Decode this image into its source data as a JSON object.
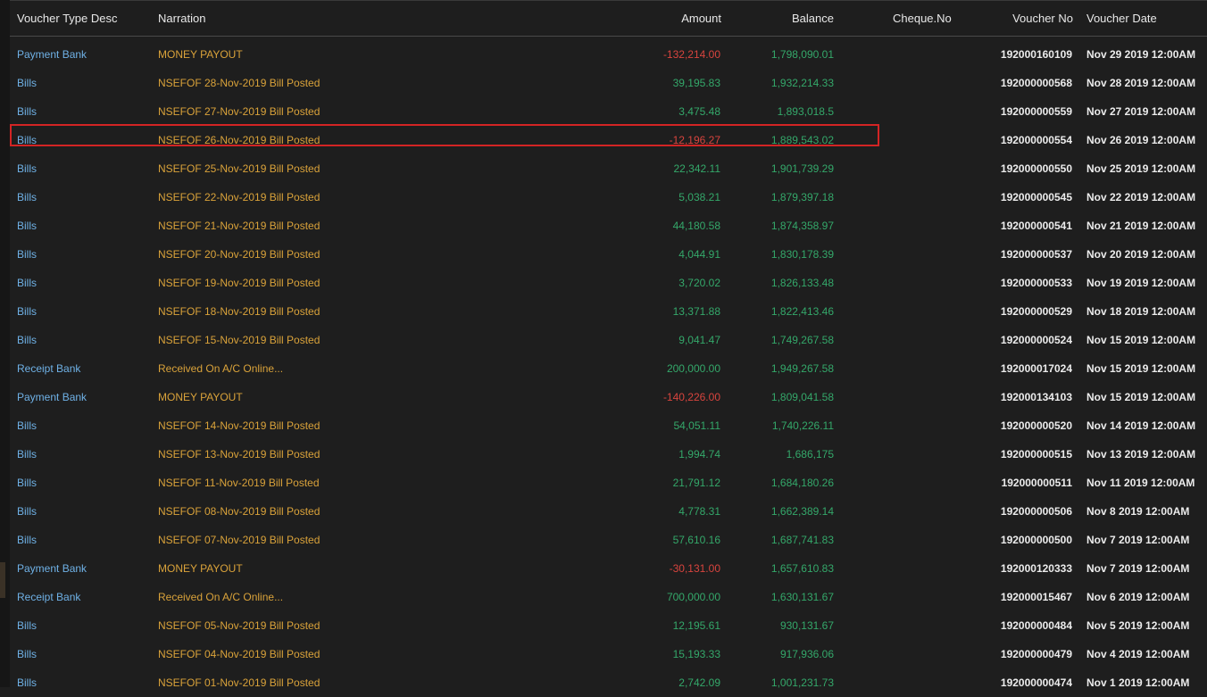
{
  "headers": {
    "type": "Voucher Type Desc",
    "narration": "Narration",
    "amount": "Amount",
    "balance": "Balance",
    "cheque": "Cheque.No",
    "voucher_no": "Voucher No",
    "voucher_date": "Voucher Date"
  },
  "colors": {
    "background": "#1e1e1e",
    "type_text": "#6fb1e6",
    "narration_text": "#d9a23a",
    "positive_amount": "#34a86a",
    "negative_amount": "#d8443e",
    "highlight_border": "#d32424"
  },
  "highlighted_row_index": 3,
  "rows": [
    {
      "type": "Payment Bank",
      "narration": "MONEY PAYOUT",
      "amount": "-132,214.00",
      "negative": true,
      "balance": "1,798,090.01",
      "cheque": "",
      "voucher_no": "192000160109",
      "voucher_date": "Nov 29 2019 12:00AM"
    },
    {
      "type": "Bills",
      "narration": "NSEFOF 28-Nov-2019 Bill Posted",
      "amount": "39,195.83",
      "negative": false,
      "balance": "1,932,214.33",
      "cheque": "",
      "voucher_no": "192000000568",
      "voucher_date": "Nov 28 2019 12:00AM"
    },
    {
      "type": "Bills",
      "narration": "NSEFOF 27-Nov-2019 Bill Posted",
      "amount": "3,475.48",
      "negative": false,
      "balance": "1,893,018.5",
      "cheque": "",
      "voucher_no": "192000000559",
      "voucher_date": "Nov 27 2019 12:00AM"
    },
    {
      "type": "Bills",
      "narration": "NSEFOF 26-Nov-2019 Bill Posted",
      "amount": "-12,196.27",
      "negative": true,
      "balance": "1,889,543.02",
      "cheque": "",
      "voucher_no": "192000000554",
      "voucher_date": "Nov 26 2019 12:00AM"
    },
    {
      "type": "Bills",
      "narration": "NSEFOF 25-Nov-2019 Bill Posted",
      "amount": "22,342.11",
      "negative": false,
      "balance": "1,901,739.29",
      "cheque": "",
      "voucher_no": "192000000550",
      "voucher_date": "Nov 25 2019 12:00AM"
    },
    {
      "type": "Bills",
      "narration": "NSEFOF 22-Nov-2019 Bill Posted",
      "amount": "5,038.21",
      "negative": false,
      "balance": "1,879,397.18",
      "cheque": "",
      "voucher_no": "192000000545",
      "voucher_date": "Nov 22 2019 12:00AM"
    },
    {
      "type": "Bills",
      "narration": "NSEFOF 21-Nov-2019 Bill Posted",
      "amount": "44,180.58",
      "negative": false,
      "balance": "1,874,358.97",
      "cheque": "",
      "voucher_no": "192000000541",
      "voucher_date": "Nov 21 2019 12:00AM"
    },
    {
      "type": "Bills",
      "narration": "NSEFOF 20-Nov-2019 Bill Posted",
      "amount": "4,044.91",
      "negative": false,
      "balance": "1,830,178.39",
      "cheque": "",
      "voucher_no": "192000000537",
      "voucher_date": "Nov 20 2019 12:00AM"
    },
    {
      "type": "Bills",
      "narration": "NSEFOF 19-Nov-2019 Bill Posted",
      "amount": "3,720.02",
      "negative": false,
      "balance": "1,826,133.48",
      "cheque": "",
      "voucher_no": "192000000533",
      "voucher_date": "Nov 19 2019 12:00AM"
    },
    {
      "type": "Bills",
      "narration": "NSEFOF 18-Nov-2019 Bill Posted",
      "amount": "13,371.88",
      "negative": false,
      "balance": "1,822,413.46",
      "cheque": "",
      "voucher_no": "192000000529",
      "voucher_date": "Nov 18 2019 12:00AM"
    },
    {
      "type": "Bills",
      "narration": "NSEFOF 15-Nov-2019 Bill Posted",
      "amount": "9,041.47",
      "negative": false,
      "balance": "1,749,267.58",
      "cheque": "",
      "voucher_no": "192000000524",
      "voucher_date": "Nov 15 2019 12:00AM"
    },
    {
      "type": "Receipt Bank",
      "narration": "Received On A/C Online...",
      "amount": "200,000.00",
      "negative": false,
      "balance": "1,949,267.58",
      "cheque": "",
      "voucher_no": "192000017024",
      "voucher_date": "Nov 15 2019 12:00AM"
    },
    {
      "type": "Payment Bank",
      "narration": "MONEY PAYOUT",
      "amount": "-140,226.00",
      "negative": true,
      "balance": "1,809,041.58",
      "cheque": "",
      "voucher_no": "192000134103",
      "voucher_date": "Nov 15 2019 12:00AM"
    },
    {
      "type": "Bills",
      "narration": "NSEFOF 14-Nov-2019 Bill Posted",
      "amount": "54,051.11",
      "negative": false,
      "balance": "1,740,226.11",
      "cheque": "",
      "voucher_no": "192000000520",
      "voucher_date": "Nov 14 2019 12:00AM"
    },
    {
      "type": "Bills",
      "narration": "NSEFOF 13-Nov-2019 Bill Posted",
      "amount": "1,994.74",
      "negative": false,
      "balance": "1,686,175",
      "cheque": "",
      "voucher_no": "192000000515",
      "voucher_date": "Nov 13 2019 12:00AM"
    },
    {
      "type": "Bills",
      "narration": "NSEFOF 11-Nov-2019 Bill Posted",
      "amount": "21,791.12",
      "negative": false,
      "balance": "1,684,180.26",
      "cheque": "",
      "voucher_no": "192000000511",
      "voucher_date": "Nov 11 2019 12:00AM"
    },
    {
      "type": "Bills",
      "narration": "NSEFOF 08-Nov-2019 Bill Posted",
      "amount": "4,778.31",
      "negative": false,
      "balance": "1,662,389.14",
      "cheque": "",
      "voucher_no": "192000000506",
      "voucher_date": "Nov 8 2019 12:00AM"
    },
    {
      "type": "Bills",
      "narration": "NSEFOF 07-Nov-2019 Bill Posted",
      "amount": "57,610.16",
      "negative": false,
      "balance": "1,687,741.83",
      "cheque": "",
      "voucher_no": "192000000500",
      "voucher_date": "Nov 7 2019 12:00AM"
    },
    {
      "type": "Payment Bank",
      "narration": "MONEY PAYOUT",
      "amount": "-30,131.00",
      "negative": true,
      "balance": "1,657,610.83",
      "cheque": "",
      "voucher_no": "192000120333",
      "voucher_date": "Nov 7 2019 12:00AM"
    },
    {
      "type": "Receipt Bank",
      "narration": "Received On A/C Online...",
      "amount": "700,000.00",
      "negative": false,
      "balance": "1,630,131.67",
      "cheque": "",
      "voucher_no": "192000015467",
      "voucher_date": "Nov 6 2019 12:00AM"
    },
    {
      "type": "Bills",
      "narration": "NSEFOF 05-Nov-2019 Bill Posted",
      "amount": "12,195.61",
      "negative": false,
      "balance": "930,131.67",
      "cheque": "",
      "voucher_no": "192000000484",
      "voucher_date": "Nov 5 2019 12:00AM"
    },
    {
      "type": "Bills",
      "narration": "NSEFOF 04-Nov-2019 Bill Posted",
      "amount": "15,193.33",
      "negative": false,
      "balance": "917,936.06",
      "cheque": "",
      "voucher_no": "192000000479",
      "voucher_date": "Nov 4 2019 12:00AM"
    },
    {
      "type": "Bills",
      "narration": "NSEFOF 01-Nov-2019 Bill Posted",
      "amount": "2,742.09",
      "negative": false,
      "balance": "1,001,231.73",
      "cheque": "",
      "voucher_no": "192000000474",
      "voucher_date": "Nov 1 2019 12:00AM"
    }
  ]
}
